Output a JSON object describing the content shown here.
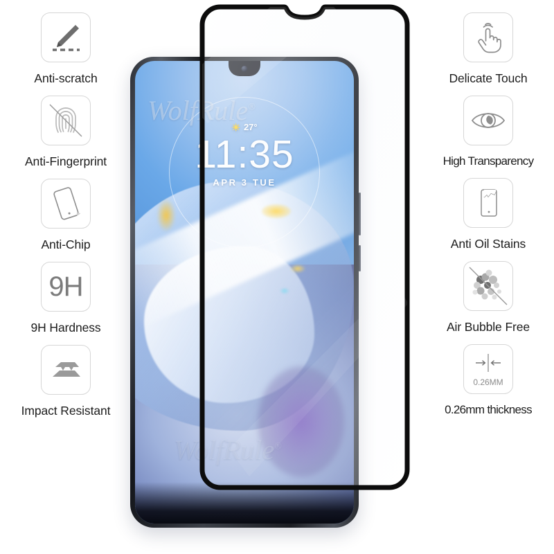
{
  "product": {
    "brand_watermark": "WolfRule",
    "brand_mark_symbol": "®"
  },
  "features_left": [
    {
      "icon": "scratch-pen-icon",
      "label": "Anti-scratch"
    },
    {
      "icon": "fingerprint-block-icon",
      "label": "Anti-Fingerprint"
    },
    {
      "icon": "phone-chip-icon",
      "label": "Anti-Chip"
    },
    {
      "icon": "hardness-9h-icon",
      "label": "9H Hardness",
      "icon_text": "9H"
    },
    {
      "icon": "impact-layers-icon",
      "label": "Impact Resistant"
    }
  ],
  "features_right": [
    {
      "icon": "touch-hand-icon",
      "label": "Delicate Touch"
    },
    {
      "icon": "eye-icon",
      "label": "High Transparency"
    },
    {
      "icon": "phone-oil-stain-icon",
      "label": "Anti Oil Stains"
    },
    {
      "icon": "air-bubble-block-icon",
      "label": "Air Bubble Free"
    },
    {
      "icon": "thickness-arrows-icon",
      "label": "0.26mm thickness",
      "icon_text": "0.26MM"
    }
  ],
  "phone": {
    "lockscreen": {
      "time": "11:35",
      "date": "APR  3  TUE",
      "weather_temp": "27°",
      "weather_icon": "sun-icon"
    }
  },
  "colors": {
    "text": "#1c1c1c",
    "icon_stroke": "#6e6e6e",
    "icon_border": "#d6d6d6",
    "glass_border": "#111111",
    "accent_yellow": "#ffd43b"
  }
}
